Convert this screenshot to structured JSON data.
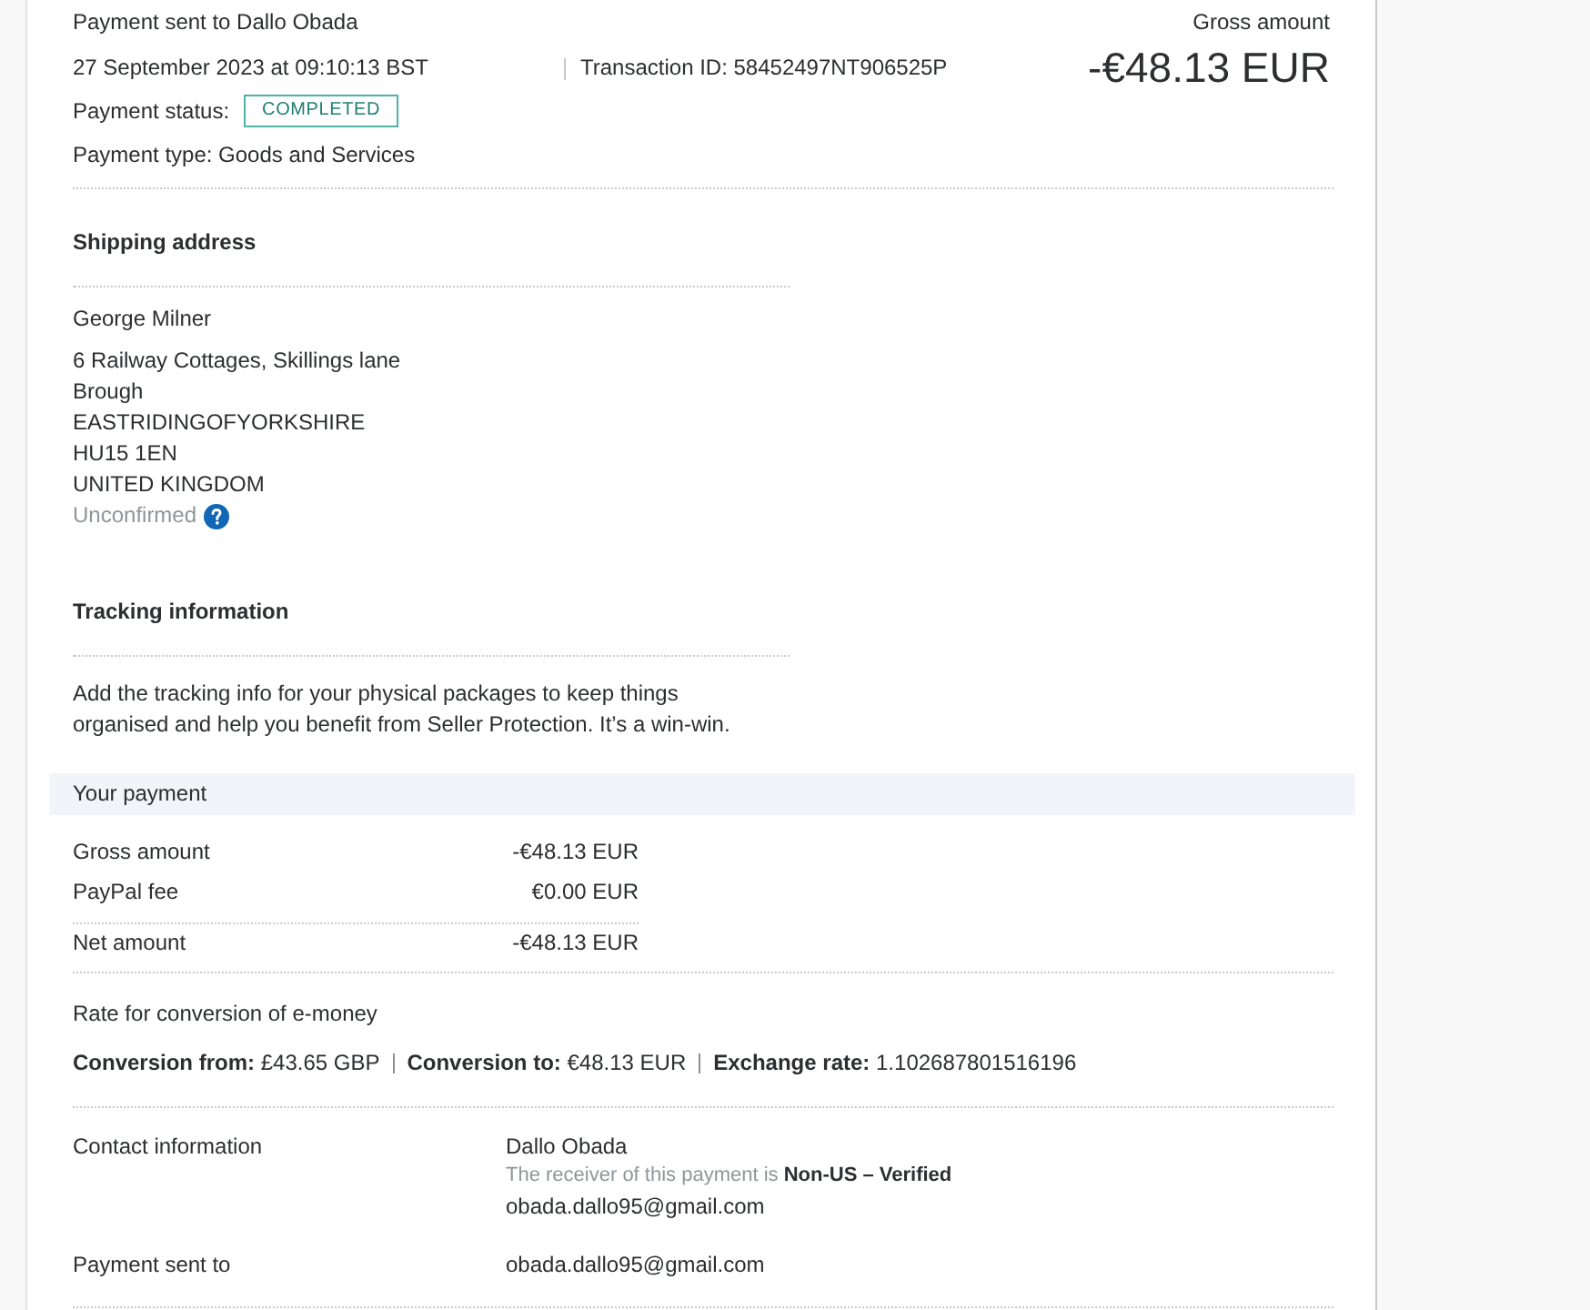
{
  "header": {
    "title": "Payment sent to Dallo Obada",
    "date": "27 September 2023 at 09:10:13 BST",
    "transaction_id": "Transaction ID: 58452497NT906525P",
    "status": {
      "label": "Payment status:",
      "value": "COMPLETED"
    },
    "payment_type": "Payment type: Goods and Services",
    "gross": {
      "label": "Gross amount",
      "amount": "-€48.13 EUR"
    }
  },
  "shipping_address": {
    "heading": "Shipping address",
    "name": "George Milner",
    "lines": [
      "6 Railway Cottages, Skillings lane",
      "Brough",
      "EASTRIDINGOFYORKSHIRE",
      "HU15 1EN",
      "UNITED KINGDOM"
    ],
    "confirmation": "Unconfirmed"
  },
  "tracking": {
    "heading": "Tracking information",
    "text": "Add the tracking info for your physical packages to keep things organised and help you benefit from Seller Protection. It’s a win-win."
  },
  "your_payment": {
    "heading": "Your payment",
    "rows": [
      {
        "label": "Gross amount",
        "value": "-€48.13 EUR"
      },
      {
        "label": "PayPal fee",
        "value": "€0.00 EUR"
      }
    ],
    "net": {
      "label": "Net amount",
      "value": "-€48.13 EUR"
    },
    "conversion": {
      "heading": "Rate for conversion of e-money",
      "items": [
        "**Conversion from:** £43.65 GBP",
        "**Conversion to:** €48.13 EUR",
        "**Exchange rate:** 1.102687801516196"
      ]
    }
  },
  "contact": {
    "label": "Contact information",
    "name": "Dallo Obada",
    "note": "The receiver of this payment is **Non-US – Verified**",
    "email": "obada.dallo95@gmail.com"
  },
  "sent_to": {
    "label": "Payment sent to",
    "email": "obada.dallo95@gmail.com"
  }
}
